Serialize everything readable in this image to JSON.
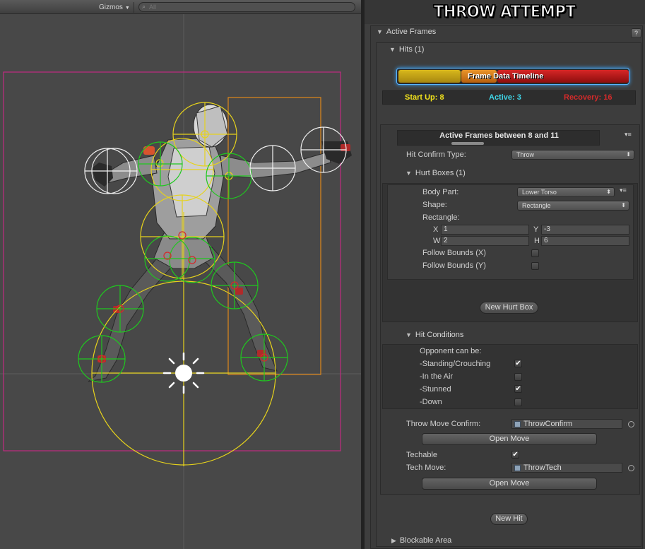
{
  "scene_toolbar": {
    "gizmos_label": "Gizmos",
    "search_placeholder": "All"
  },
  "inspector": {
    "title": "THROW ATTEMPT",
    "active_frames_label": "Active Frames",
    "help_label": "?",
    "hits_label": "Hits (1)",
    "timeline": {
      "label": "Frame Data Timeline",
      "startup_label": "Start Up: 8",
      "active_label": "Active: 3",
      "recovery_label": "Recovery: 16",
      "startup_color": "#f2e21c",
      "active_color": "#3fd6e8",
      "recovery_color": "#d42a2a"
    },
    "active_frames_range": "Active Frames between 8 and 11",
    "hit_confirm_type_label": "Hit Confirm Type:",
    "hit_confirm_type_value": "Throw",
    "hurt_boxes_label": "Hurt Boxes (1)",
    "hurt_box": {
      "body_part_label": "Body Part:",
      "body_part_value": "Lower Torso",
      "shape_label": "Shape:",
      "shape_value": "Rectangle",
      "rectangle_label": "Rectangle:",
      "x_label": "X",
      "x_value": "1",
      "y_label": "Y",
      "y_value": "-3",
      "w_label": "W",
      "w_value": "2",
      "h_label": "H",
      "h_value": "6",
      "follow_bounds_x_label": "Follow Bounds (X)",
      "follow_bounds_x_checked": false,
      "follow_bounds_y_label": "Follow Bounds (Y)",
      "follow_bounds_y_checked": false
    },
    "new_hurt_box_label": "New Hurt Box",
    "hit_conditions_label": "Hit Conditions",
    "opponent_can_be_label": "Opponent can be:",
    "conditions": [
      {
        "label": "-Standing/Crouching",
        "checked": true
      },
      {
        "label": "-In the Air",
        "checked": false
      },
      {
        "label": "-Stunned",
        "checked": true
      },
      {
        "label": "-Down",
        "checked": false
      }
    ],
    "throw_move_confirm_label": "Throw Move Confirm:",
    "throw_move_confirm_value": "ThrowConfirm",
    "open_move_label": "Open Move",
    "techable_label": "Techable",
    "techable_checked": true,
    "tech_move_label": "Tech Move:",
    "tech_move_value": "ThrowTech",
    "open_move_label_2": "Open Move",
    "new_hit_label": "New Hit",
    "blockable_area_label": "Blockable Area",
    "check_glyph": "✔"
  }
}
